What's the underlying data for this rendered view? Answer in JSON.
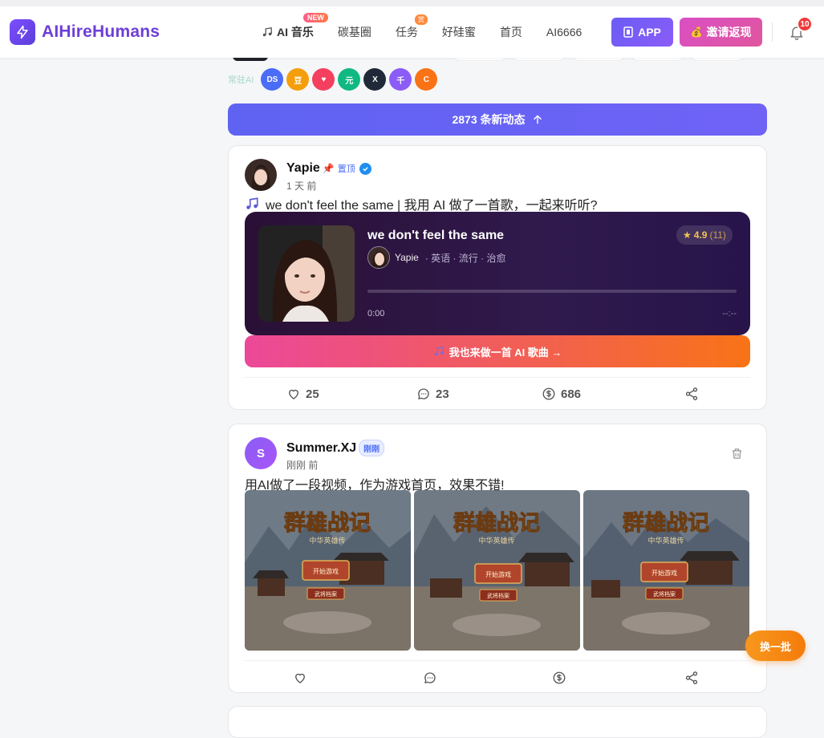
{
  "header": {
    "logo_text": "AIHireHumans",
    "nav": [
      {
        "label": "AI 音乐",
        "badge": "NEW"
      },
      {
        "label": "碳基圈"
      },
      {
        "label": "任务",
        "badge": "赏"
      },
      {
        "label": "好硅蜜"
      },
      {
        "label": "首页"
      },
      {
        "label": "AI6666"
      }
    ],
    "app_button": "APP",
    "invite_button": "邀请返现",
    "notification_count": "10"
  },
  "ai_row": {
    "label": "常驻AI",
    "chips": [
      {
        "text": "DS",
        "color": "#4a6cf7"
      },
      {
        "text": "豆",
        "color": "#f59e0b"
      },
      {
        "text": "♥",
        "color": "#f43f5e"
      },
      {
        "text": "元",
        "color": "#10b981"
      },
      {
        "text": "X",
        "color": "#1f2937"
      },
      {
        "text": "千",
        "color": "#8b5cf6"
      },
      {
        "text": "C",
        "color": "#f97316"
      }
    ]
  },
  "new_posts_bar": "2873 条新动态",
  "post1": {
    "author": "Yapie",
    "pin_label": "置顶",
    "time": "1 天 前",
    "text": "we don't feel the same | 我用 AI 做了一首歌，一起来听听?",
    "song": {
      "title": "we don't feel the same",
      "rating": "4.9",
      "rating_count": "(11)",
      "singer": "Yapie",
      "tags": "· 英语 · 流行 · 治愈",
      "time_current": "0:00",
      "time_total": "--:--",
      "progress": 0
    },
    "make_button": "我也来做一首 AI 歌曲 →",
    "likes": "25",
    "comments": "23",
    "tips": "686"
  },
  "post2": {
    "avatar_letter": "S",
    "author": "Summer.XJ",
    "tag": "刚刚",
    "time": "刚刚 前",
    "text": "用AI做了一段视频，作为游戏首页，效果不错!",
    "image_caption": "群雄战记",
    "image_subcaption": "中华英雄传",
    "image_btn1": "开始游戏",
    "image_btn2": "武将档案"
  },
  "swap_button": "换一批",
  "colors": {
    "brand": "#6d3fd8",
    "new_bar": "#6366f1",
    "player_bg": "#2a1036",
    "make_btn_start": "#ec4899",
    "make_btn_end": "#f97316",
    "swap_btn": "#f57c0b"
  }
}
